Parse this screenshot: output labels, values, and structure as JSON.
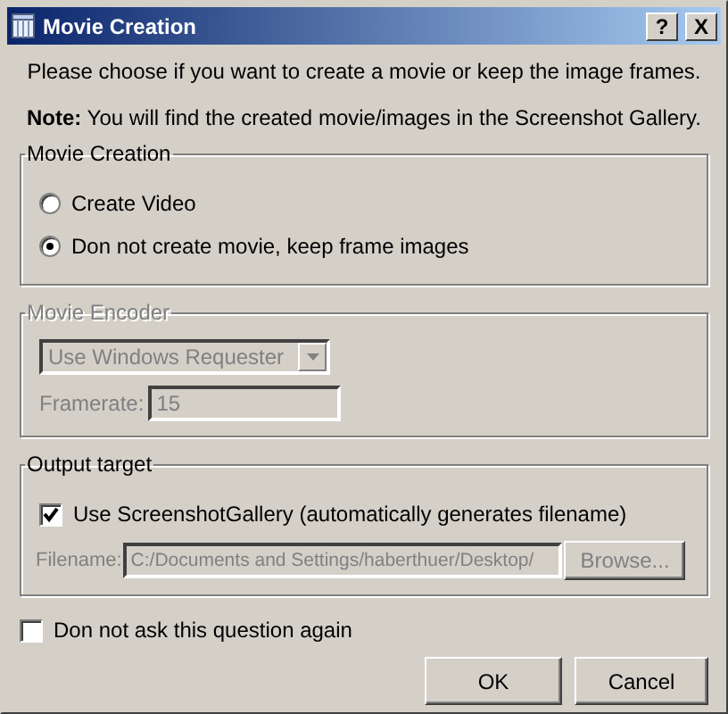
{
  "window": {
    "title": "Movie Creation",
    "controls": [
      "?",
      "X"
    ]
  },
  "intro": "Please choose if you want to create a movie or keep the image frames.",
  "note": "**Note:** You will find the created movie/images in the Screenshot Gallery.",
  "movie_creation": {
    "title": "Movie Creation",
    "options": [
      {
        "label": "Create Video",
        "selected": false
      },
      {
        "label": "Don not create movie, keep frame images",
        "selected": true
      }
    ]
  },
  "movie_encoder": {
    "title": "Movie Encoder",
    "disabled": true,
    "encoder": "Use Windows Requester",
    "framerate_label": "Framerate:",
    "framerate": "15"
  },
  "output_target": {
    "title": "Output target",
    "use_gallery": {
      "label": "Use ScreenshotGallery (automatically generates filename)",
      "checked": true
    },
    "disabled": true,
    "filename_label": "Filename:",
    "filename": "C:/Documents and Settings/haberthuer/Desktop/",
    "browse": "Browse..."
  },
  "dont_ask": {
    "label": "Don not ask this question again",
    "checked": false
  },
  "buttons": [
    "OK",
    "Cancel"
  ]
}
